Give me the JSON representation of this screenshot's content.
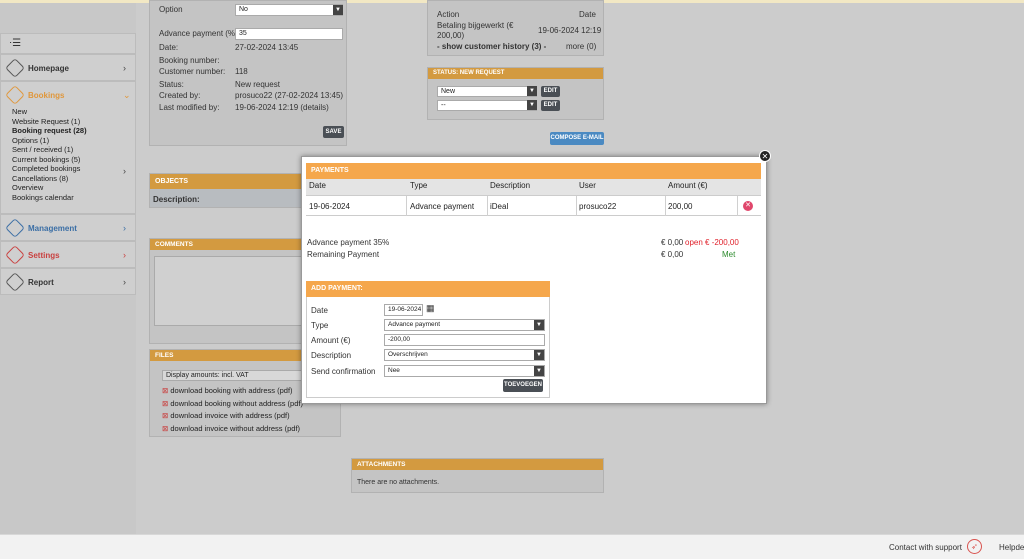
{
  "sidebar": {
    "menu_icon": "hamburger-icon",
    "items": [
      {
        "label": "Homepage",
        "icon": "home-icon"
      },
      {
        "label": "Bookings",
        "icon": "bookings-icon"
      },
      {
        "label": "Management",
        "icon": "management-icon"
      },
      {
        "label": "Settings",
        "icon": "settings-icon"
      },
      {
        "label": "Report",
        "icon": "report-icon"
      }
    ],
    "bookings_sub": [
      "New",
      "Website Request (1)",
      "Booking request (28)",
      "Options (1)",
      "Sent / received (1)",
      "Current bookings (5)",
      "Completed bookings",
      "Cancellations (8)",
      "Overview",
      "Bookings calendar"
    ]
  },
  "booking": {
    "option_label": "Option",
    "option_value": "No",
    "advance_label": "Advance payment (%):",
    "advance_value": "35",
    "date_label": "Date:",
    "date_value": "27-02-2024 13:45",
    "booking_number_label": "Booking number:",
    "customer_number_label": "Customer number:",
    "customer_number_value": "118",
    "status_label": "Status:",
    "status_value": "New request",
    "created_label": "Created by:",
    "created_value": "prosuco22 (27-02-2024 13:45)",
    "modified_label": "Last modified by:",
    "modified_value": "19-06-2024 12:19 (details)",
    "save_label": "SAVE"
  },
  "objects": {
    "header": "OBJECTS",
    "description_label": "Description:"
  },
  "comments": {
    "header": "COMMENTS"
  },
  "files": {
    "header": "FILES",
    "display_select": "Display amounts: incl. VAT",
    "links": [
      "download booking with address (pdf)",
      "download booking without address (pdf)",
      "download invoice with address (pdf)",
      "download invoice without address (pdf)"
    ]
  },
  "history": {
    "action_header": "Action",
    "date_header": "Date",
    "action_value": "Betaling bijgewerkt (€ 200,00)",
    "date_value": "19-06-2024 12:19",
    "show_history": "- show customer history (3) -",
    "more": "more (0)"
  },
  "status": {
    "header": "STATUS: NEW REQUEST",
    "select1": "New",
    "select2": "--",
    "edit_label": "EDIT"
  },
  "compose_label": "COMPOSE E-MAIL",
  "attachments": {
    "header": "ATTACHMENTS",
    "text": "There are no attachments."
  },
  "payments": {
    "header": "PAYMENTS",
    "columns": [
      "Date",
      "Type",
      "Description",
      "User",
      "Amount (€)"
    ],
    "rows": [
      {
        "date": "19-06-2024",
        "type": "Advance payment",
        "description": "iDeal",
        "user": "prosuco22",
        "amount": "200,00"
      }
    ],
    "summary": [
      {
        "label": "Advance payment 35%",
        "amount": "€ 0,00",
        "status": "open € -200,00",
        "status_color": "#e0212b"
      },
      {
        "label": "Remaining Payment",
        "amount": "€ 0,00",
        "status": "Met",
        "status_color": "#2e8b2e"
      }
    ]
  },
  "add_payment": {
    "header": "ADD PAYMENT:",
    "date_label": "Date",
    "date_value": "19-06-2024",
    "type_label": "Type",
    "type_value": "Advance payment",
    "amount_label": "Amount (€)",
    "amount_value": "-200,00",
    "description_label": "Description",
    "description_value": "Overschrijven",
    "send_label": "Send confirmation",
    "send_value": "Nee",
    "submit_label": "TOEVOEGEN"
  },
  "footer": {
    "support": "Contact with support",
    "helpdesk": "Helpde"
  },
  "colors": {
    "accent": "#d39a40",
    "modal_header": "#f5a74c",
    "bookings": "#e0973b",
    "settings": "#c9403f",
    "management": "#3a6ea5"
  }
}
